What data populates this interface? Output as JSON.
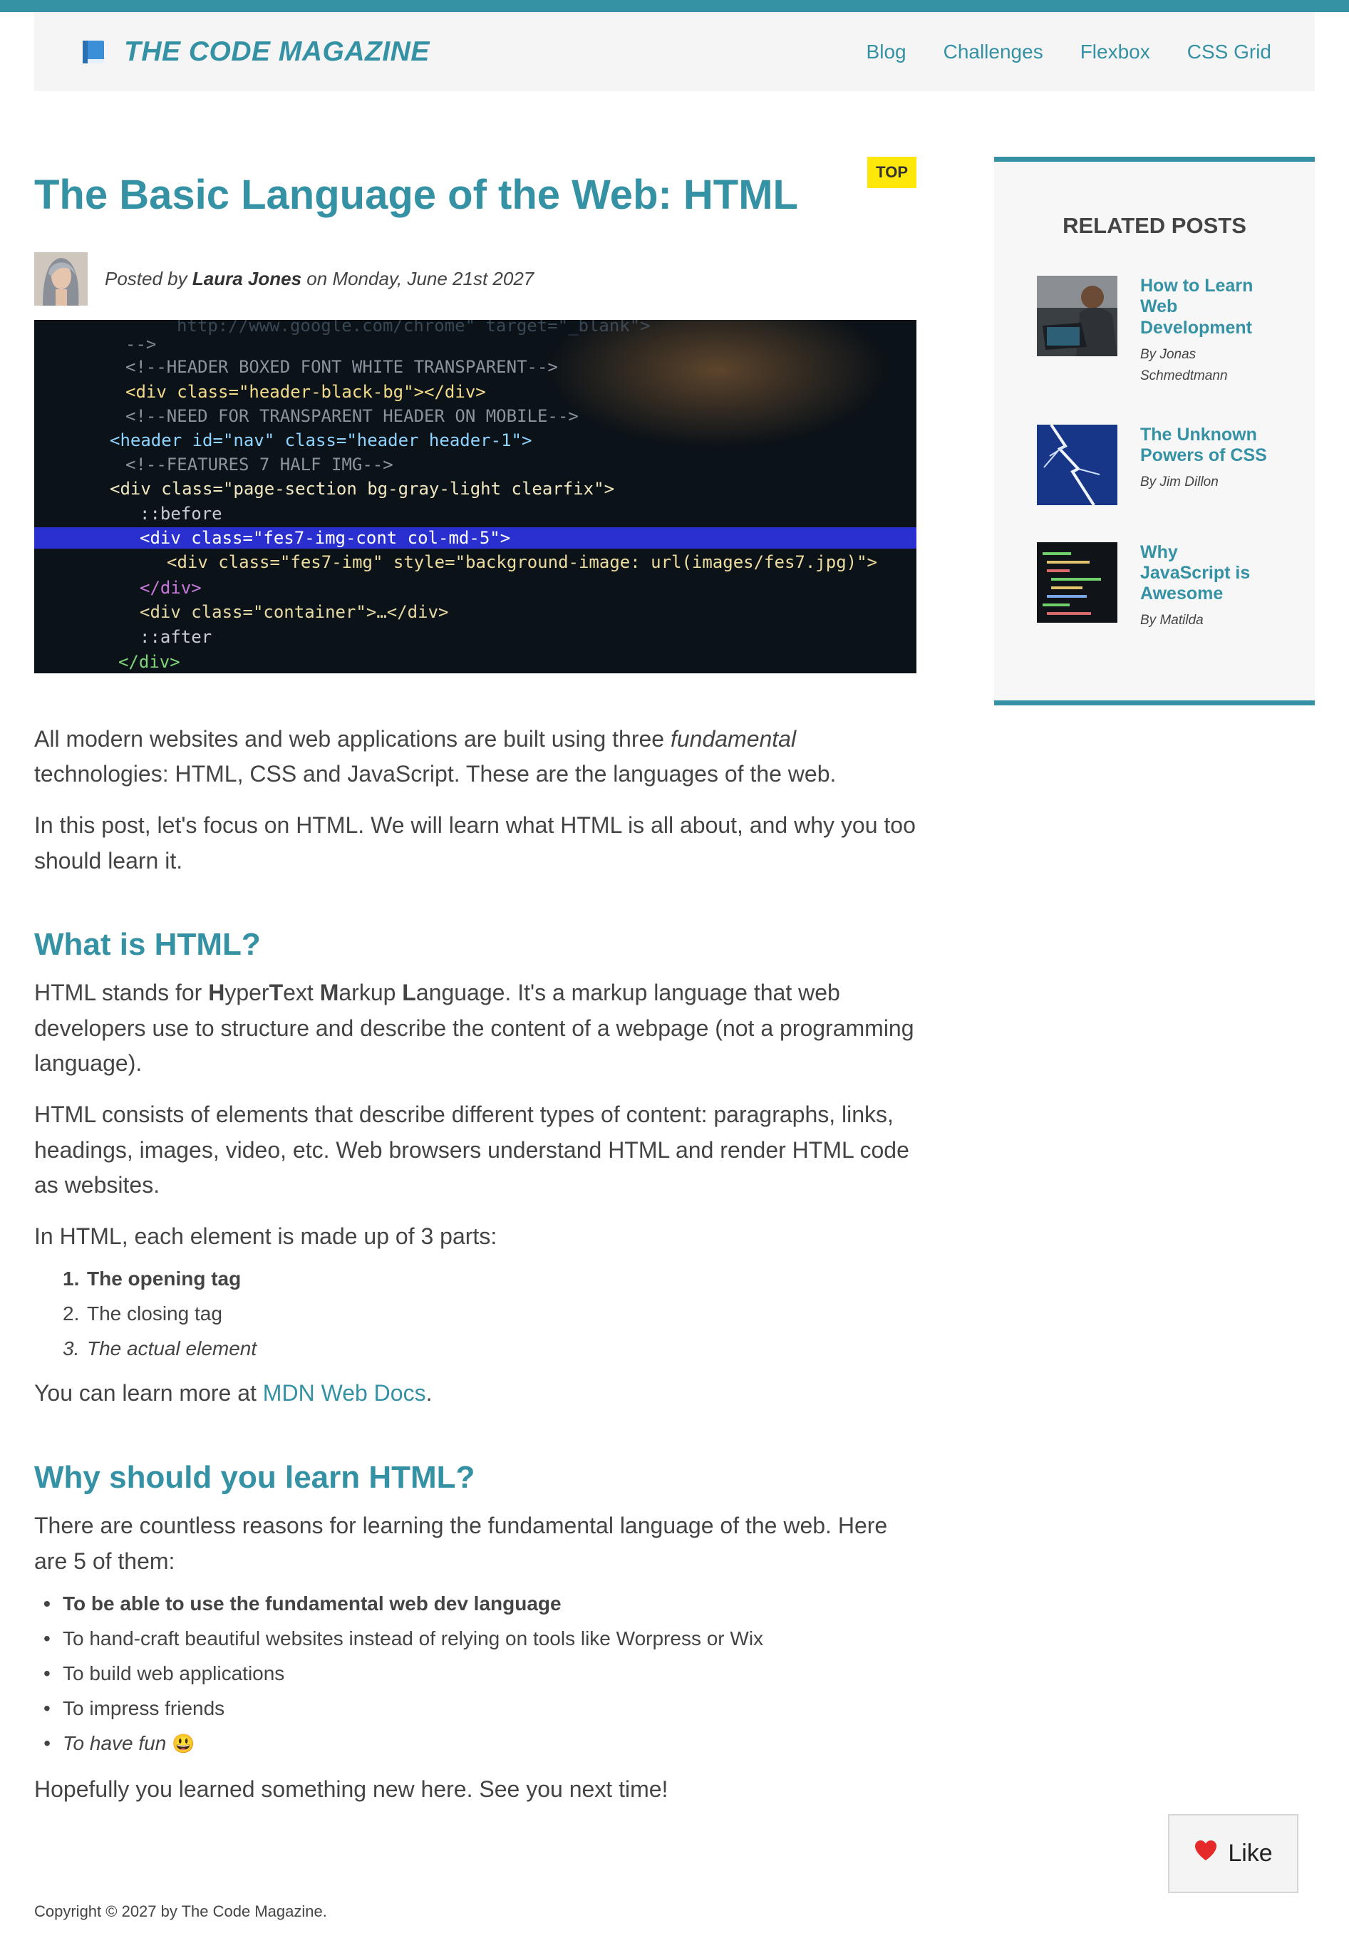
{
  "colors": {
    "accent": "#3591a4",
    "tag": "#ffe70a",
    "header_bg": "#f5f5f5"
  },
  "header": {
    "brand_icon": "book-icon",
    "brand": "THE CODE MAGAZINE",
    "nav": [
      "Blog",
      "Challenges",
      "Flexbox",
      "CSS Grid"
    ]
  },
  "article": {
    "title": "The Basic Language of the Web: HTML",
    "tag": "TOP",
    "meta": {
      "prefix": "Posted by",
      "author": "Laura Jones",
      "on": "on",
      "date": "Monday, June 21st 2027"
    },
    "hero_code": [
      "http://www.google.com/chrome\" target=\"_blank\">",
      "-->",
      "<!--HEADER BOXED FONT WHITE TRANSPARENT-->",
      "<div class=\"header-black-bg\"></div>",
      "<!--NEED FOR TRANSPARENT HEADER ON MOBILE-->",
      "<header id=\"nav\" class=\"header header-1\">",
      "<!--FEATURES 7 HALF IMG-->",
      "<div class=\"page-section bg-gray-light clearfix\">",
      "::before",
      "<div class=\"fes7-img-cont col-md-5\">",
      "<div class=\"fes7-img\" style=\"background-image: url(images/fes7.jpg)\">",
      "</div>",
      "<div class=\"container\">…</div>",
      "::after",
      "</div>"
    ],
    "intro_1a": "All modern websites and web applications are built using three ",
    "intro_1_em": "fundamental",
    "intro_1b": " technologies: HTML, CSS and JavaScript. These are the languages of the web.",
    "intro_2": "In this post, let's focus on HTML. We will learn what HTML is all about, and why you too should learn it.",
    "h2_what": "What is HTML?",
    "what_1": {
      "pre": "HTML stands for ",
      "H": "H",
      "yper": "yper",
      "T": "T",
      "ext": "ext ",
      "M": "M",
      "arkup": "arkup ",
      "L": "L",
      "anguage": "anguage",
      "post": ". It's a markup language that web developers use to structure and describe the content of a webpage (not a programming language)."
    },
    "what_2": "HTML consists of elements that describe different types of content: paragraphs, links, headings, images, video, etc. Web browsers understand HTML and render HTML code as websites.",
    "what_3": "In HTML, each element is made up of 3 parts:",
    "parts": [
      {
        "num": "1.",
        "text": "The opening tag"
      },
      {
        "num": "2.",
        "text": "The closing tag"
      },
      {
        "num": "3.",
        "text": "The actual element"
      }
    ],
    "learn_more": {
      "pre": "You can learn more at ",
      "link": "MDN Web Docs",
      "post": "."
    },
    "h2_why": "Why should you learn HTML?",
    "why_1": "There are countless reasons for learning the fundamental language of the web. Here are 5 of them:",
    "reasons": [
      "To be able to use the fundamental web dev language",
      "To hand-craft beautiful websites instead of relying on tools like Worpress or Wix",
      "To build web applications",
      "To impress friends",
      "To have fun"
    ],
    "reason_emoji": "😃",
    "closing": "Hopefully you learned something new here. See you next time!"
  },
  "aside": {
    "title": "Related posts",
    "posts": [
      {
        "title": "How to Learn Web Development",
        "author": "By Jonas Schmedtmann",
        "thumb": "laptop-photo"
      },
      {
        "title": "The Unknown Powers of CSS",
        "author": "By Jim Dillon",
        "thumb": "lightning-photo"
      },
      {
        "title": "Why JavaScript is Awesome",
        "author": "By Matilda",
        "thumb": "code-screen-photo"
      }
    ]
  },
  "footer": "Copyright © 2027 by The Code Magazine.",
  "like": {
    "label": "Like",
    "icon": "heart-icon"
  }
}
